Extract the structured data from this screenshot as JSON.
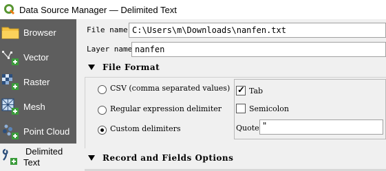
{
  "window": {
    "title": "Data Source Manager — Delimited Text",
    "icon": "qgis-logo-icon"
  },
  "sidebar": {
    "items": [
      {
        "label": "Browser",
        "icon": "folder-icon",
        "selected": false
      },
      {
        "label": "Vector",
        "icon": "vector-add-icon",
        "selected": false
      },
      {
        "label": "Raster",
        "icon": "raster-add-icon",
        "selected": false
      },
      {
        "label": "Mesh",
        "icon": "mesh-add-icon",
        "selected": false
      },
      {
        "label": "Point Cloud",
        "icon": "point-cloud-add-icon",
        "selected": false
      },
      {
        "label_line1": "Delimited",
        "label_line2": "Text",
        "icon": "delimited-text-add-icon",
        "selected": true
      }
    ]
  },
  "form": {
    "file_name_label": "File name",
    "file_name_value": "C:\\Users\\m\\Downloads\\nanfen.txt",
    "layer_name_label": "Layer name",
    "layer_name_value": "nanfen"
  },
  "file_format": {
    "title": "File Format",
    "options": [
      {
        "label": "CSV (comma separated values)",
        "checked": false
      },
      {
        "label": "Regular expression delimiter",
        "checked": false
      },
      {
        "label": "Custom delimiters",
        "checked": true
      }
    ],
    "delimiters": {
      "tab_label": "Tab",
      "tab_checked": true,
      "semicolon_label": "Semicolon",
      "semicolon_checked": false,
      "quote_label": "Quote",
      "quote_value": "\""
    }
  },
  "record_fields": {
    "title": "Record and Fields Options"
  },
  "colors": {
    "sidebar_bg": "#5e5e5e",
    "selected_bg": "#f0f0f0",
    "add_badge": "#3a9b3a"
  }
}
